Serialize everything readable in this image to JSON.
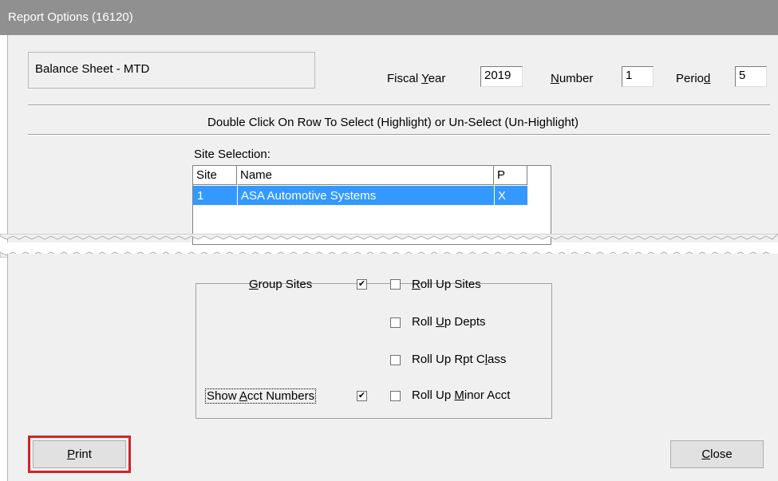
{
  "window": {
    "title": "Report Options (16120)"
  },
  "report": {
    "name": "Balance Sheet - MTD"
  },
  "fiscal": {
    "year_label_pre": "Fiscal ",
    "year_label_key": "Y",
    "year_label_post": "ear",
    "year_value": "2019",
    "number_label_key": "N",
    "number_label_post": "umber",
    "number_value": "1",
    "period_label_pre": "Perio",
    "period_label_key": "d",
    "period_value": "5"
  },
  "instruction": "Double Click On Row To Select (Highlight) or Un-Select (Un-Highlight)",
  "site_selection": {
    "label": "Site Selection:",
    "columns": [
      "Site",
      "Name",
      "P"
    ],
    "rows": [
      {
        "site": "1",
        "name": "ASA Automotive Systems",
        "p": "X"
      }
    ]
  },
  "options": {
    "group_sites": {
      "key": "G",
      "rest": "roup Sites",
      "checked": true
    },
    "show_acct_numbers": {
      "pre": "Show ",
      "key": "A",
      "rest": "cct Numbers",
      "checked": true
    },
    "roll_up_sites": {
      "key": "R",
      "rest": "oll Up Sites",
      "checked": false
    },
    "roll_up_depts": {
      "pre": "Roll ",
      "key": "U",
      "rest": "p Depts",
      "checked": false
    },
    "roll_up_rpt_class": {
      "pre": "Roll Up Rpt C",
      "key": "l",
      "rest": "ass",
      "checked": false
    },
    "roll_up_minor_acct": {
      "pre": "Roll Up ",
      "key": "M",
      "rest": "inor Acct",
      "checked": false
    }
  },
  "buttons": {
    "print": {
      "key": "P",
      "rest": "rint"
    },
    "close": {
      "key": "C",
      "rest": "lose"
    }
  },
  "colors": {
    "highlight": "#3399ff",
    "title_bar": "#909090",
    "annotation": "#d2232a"
  }
}
